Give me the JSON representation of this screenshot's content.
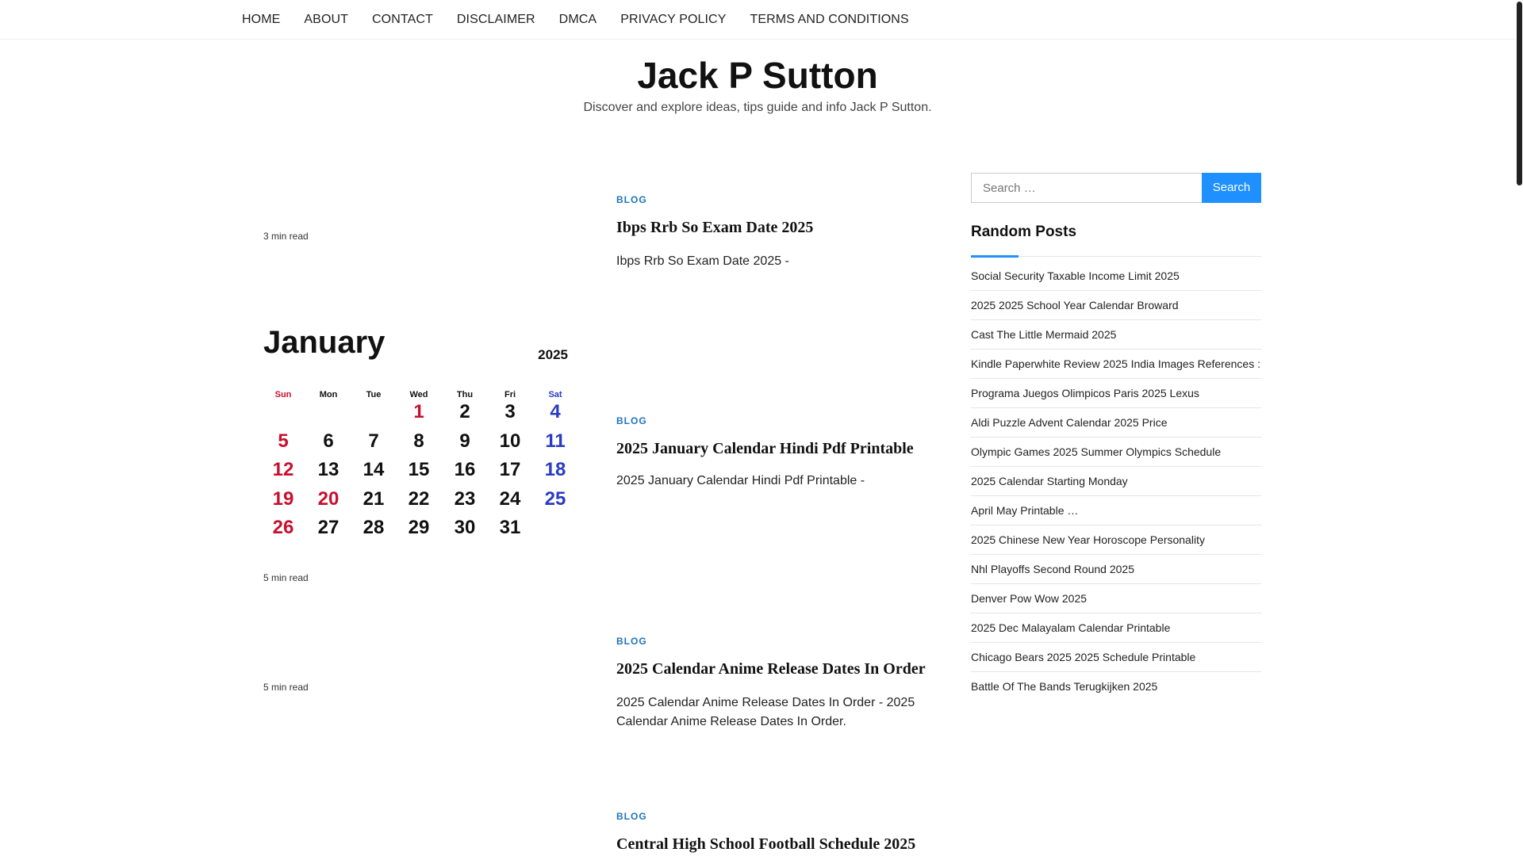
{
  "nav": {
    "items": [
      "HOME",
      "ABOUT",
      "CONTACT",
      "DISCLAIMER",
      "DMCA",
      "PRIVACY POLICY",
      "TERMS AND CONDITIONS"
    ]
  },
  "site": {
    "title": "Jack P Sutton",
    "description": "Discover and explore ideas, tips guide and info Jack P Sutton."
  },
  "posts": [
    {
      "readtime": "3 min read",
      "category": "BLOG",
      "title": "Ibps Rrb So Exam Date 2025",
      "excerpt": "Ibps Rrb So Exam Date 2025 -"
    },
    {
      "readtime": "5 min read",
      "category": "BLOG",
      "title": "2025 January Calendar Hindi Pdf Printable",
      "excerpt": "2025 January Calendar Hindi Pdf Printable -"
    },
    {
      "readtime": "5 min read",
      "category": "BLOG",
      "title": "2025 Calendar Anime Release Dates In Order",
      "excerpt": "2025 Calendar Anime Release Dates In Order - 2025 Calendar Anime Release Dates In Order."
    },
    {
      "category": "BLOG",
      "title": "Central High School Football Schedule 2025"
    }
  ],
  "calendar": {
    "month": "January",
    "year": "2025",
    "weekdays": [
      "Sun",
      "Mon",
      "Tue",
      "Wed",
      "Thu",
      "Fri",
      "Sat"
    ],
    "weeks": [
      [
        "",
        "",
        "",
        "1",
        "2",
        "3",
        "4"
      ],
      [
        "5",
        "6",
        "7",
        "8",
        "9",
        "10",
        "11"
      ],
      [
        "12",
        "13",
        "14",
        "15",
        "16",
        "17",
        "18"
      ],
      [
        "19",
        "20",
        "21",
        "22",
        "23",
        "24",
        "25"
      ],
      [
        "26",
        "27",
        "28",
        "29",
        "30",
        "31",
        ""
      ]
    ],
    "colors": {
      "sunday": "#c8102e",
      "saturday": "#2a3bc2",
      "default": "#111111"
    }
  },
  "sidebar": {
    "search_placeholder": "Search …",
    "search_button": "Search",
    "widget_title": "Random Posts",
    "random_posts": [
      "Social Security Taxable Income Limit 2025",
      "2025 2025 School Year Calendar Broward",
      "Cast The Little Mermaid 2025",
      "Kindle Paperwhite Review 2025 India Images References :",
      "Programa Juegos Olimpicos Paris 2025 Lexus",
      "Aldi Puzzle Advent Calendar 2025 Price",
      "Olympic Games 2025 Summer Olympics Schedule",
      "2025 Calendar Starting Monday",
      "April May Printable …",
      "2025 Chinese New Year Horoscope Personality",
      "Nhl Playoffs Second Round 2025",
      "Denver Pow Wow 2025",
      "2025 Dec Malayalam Calendar Printable",
      "Chicago Bears 2025 2025 Schedule Printable",
      "Battle Of The Bands Terugkijken 2025"
    ]
  },
  "theme": {
    "accent": "#1e90ff",
    "link": "#1e73be"
  }
}
